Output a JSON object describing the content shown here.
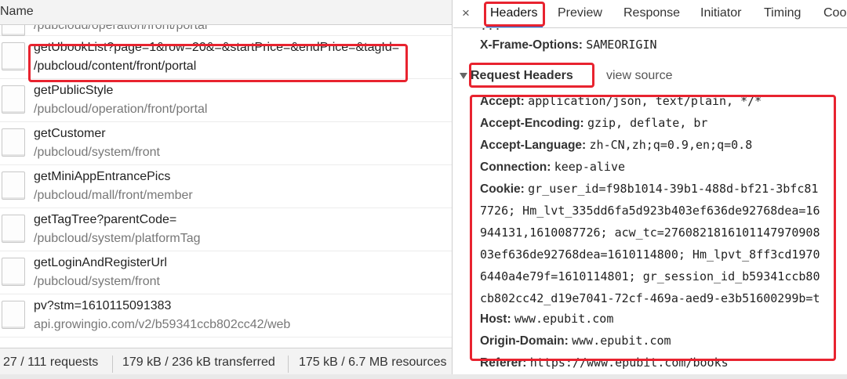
{
  "request_list": {
    "column_name": "Name",
    "partial_top_path": "/pubcloud/operation/front/portal",
    "rows": [
      {
        "name": "getUbookList?page=1&row=20&=&startPrice=&endPrice=&tagId=",
        "path": "/pubcloud/content/front/portal"
      },
      {
        "name": "getPublicStyle",
        "path": "/pubcloud/operation/front/portal"
      },
      {
        "name": "getCustomer",
        "path": "/pubcloud/system/front"
      },
      {
        "name": "getMiniAppEntrancePics",
        "path": "/pubcloud/mall/front/member"
      },
      {
        "name": "getTagTree?parentCode=",
        "path": "/pubcloud/system/platformTag"
      },
      {
        "name": "getLoginAndRegisterUrl",
        "path": "/pubcloud/system/front"
      },
      {
        "name": "pv?stm=1610115091383",
        "path": "api.growingio.com/v2/b59341ccb802cc42/web"
      }
    ]
  },
  "status_bar": {
    "requests": "27 / 111 requests",
    "transferred": "179 kB / 236 kB transferred",
    "resources": "175 kB / 6.7 MB resources"
  },
  "detail_tabs": {
    "close": "×",
    "tabs": [
      "Headers",
      "Preview",
      "Response",
      "Initiator",
      "Timing",
      "Coo"
    ]
  },
  "response_headers": {
    "partial_top_line": "                              ...",
    "x_frame_options": {
      "key": "X-Frame-Options:",
      "value": "SAMEORIGIN"
    }
  },
  "request_headers": {
    "title": "Request Headers",
    "view_source": "view source",
    "items": [
      {
        "key": "Accept:",
        "value": "application/json, text/plain, */*"
      },
      {
        "key": "Accept-Encoding:",
        "value": "gzip, deflate, br"
      },
      {
        "key": "Accept-Language:",
        "value": "zh-CN,zh;q=0.9,en;q=0.8"
      },
      {
        "key": "Connection:",
        "value": "keep-alive"
      },
      {
        "key": "Cookie:",
        "value": "gr_user_id=f98b1014-39b1-488d-bf21-3bfc81"
      }
    ],
    "cookie_continuation": [
      "7726; Hm_lvt_335dd6fa5d923b403ef636de92768dea=16",
      "944131,1610087726; acw_tc=2760821816101147970908",
      "03ef636de92768dea=1610114800; Hm_lpvt_8ff3cd1970",
      "6440a4e79f=1610114801; gr_session_id_b59341ccb80",
      "cb802cc42_d19e7041-72cf-469a-aed9-e3b51600299b=t"
    ],
    "after_cookie": [
      {
        "key": "Host:",
        "value": "www.epubit.com"
      },
      {
        "key": "Origin-Domain:",
        "value": "www.epubit.com"
      },
      {
        "key": "Referer:",
        "value": "https://www.epubit.com/books"
      }
    ]
  },
  "colors": {
    "highlight_box": "#e8232f",
    "active_tab_underline": "#1a73e8"
  }
}
